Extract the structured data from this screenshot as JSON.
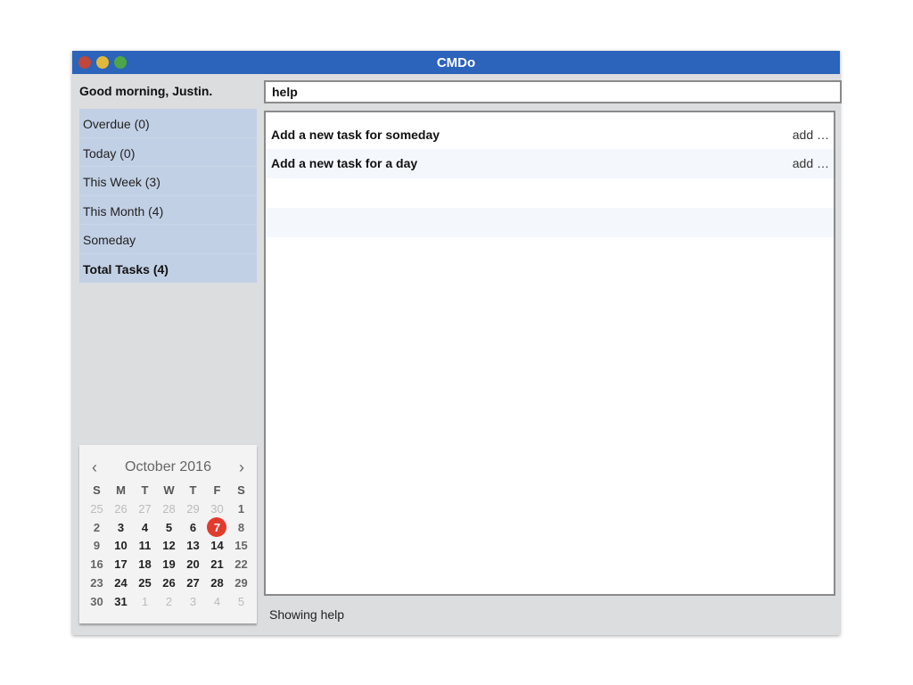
{
  "window": {
    "title": "CMDo"
  },
  "greeting": "Good morning, Justin.",
  "search": {
    "value": "help"
  },
  "sidebar": {
    "items": [
      "Overdue (0)",
      "Today (0)",
      "This Week (3)",
      "This Month (4)",
      "Someday",
      "Total Tasks (4)"
    ]
  },
  "tasks": [
    {
      "name": "Add a new task for someday",
      "command": "add …"
    },
    {
      "name": "Add a new task for a day",
      "command": "add …"
    }
  ],
  "status": "Showing help",
  "calendar": {
    "month": "October 2016",
    "weekdays": [
      "S",
      "M",
      "T",
      "W",
      "T",
      "F",
      "S"
    ],
    "days": [
      "25",
      "26",
      "27",
      "28",
      "29",
      "30",
      "1",
      "2",
      "3",
      "4",
      "5",
      "6",
      "7",
      "8",
      "9",
      "10",
      "11",
      "12",
      "13",
      "14",
      "15",
      "16",
      "17",
      "18",
      "19",
      "20",
      "21",
      "22",
      "23",
      "24",
      "25",
      "26",
      "27",
      "28",
      "29",
      "30",
      "31",
      "1",
      "2",
      "3",
      "4",
      "5"
    ],
    "today": "7",
    "prev": "‹",
    "next": "›"
  },
  "colors": {
    "titlebar": "#2c63bb",
    "sidebar": "#c2d0e5",
    "today": "#e23b2e"
  }
}
